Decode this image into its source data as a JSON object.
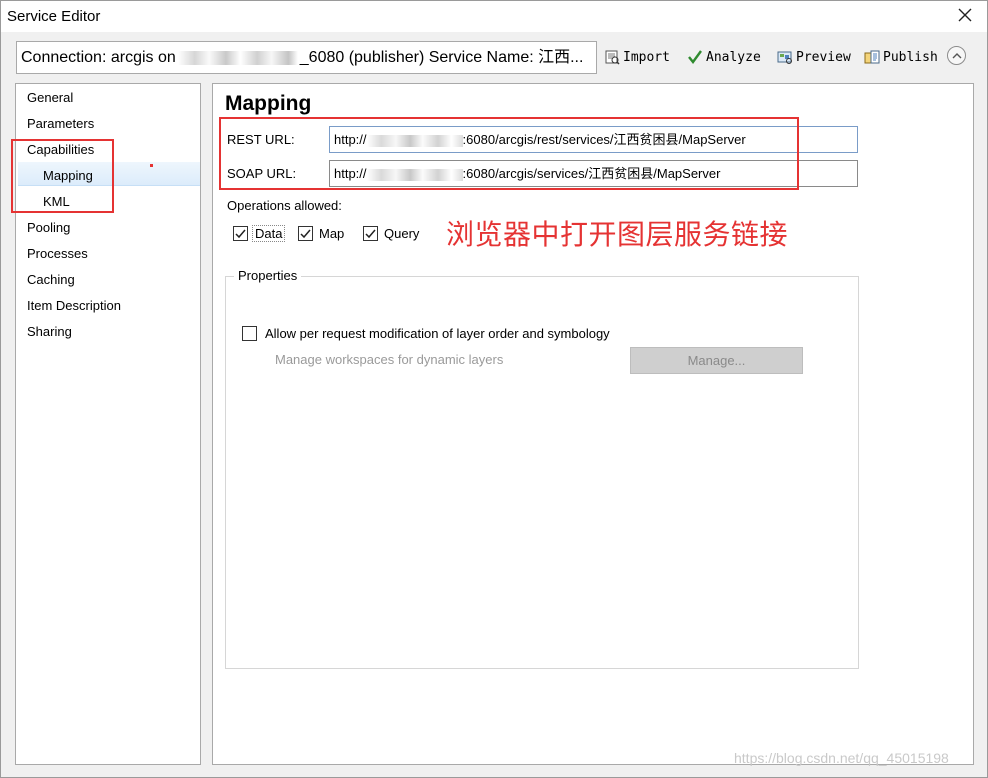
{
  "window": {
    "title": "Service Editor",
    "close_icon": "close-icon"
  },
  "toolbar": {
    "connection_prefix": "Connection: arcgis on",
    "connection_suffix": "_6080 (publisher)   Service Name: 江西...",
    "import_label": "Import",
    "analyze_label": "Analyze",
    "preview_label": "Preview",
    "publish_label": "Publish",
    "icons": [
      "import-icon",
      "analyze-check-icon",
      "preview-icon",
      "publish-icon",
      "collapse-chevron-icon"
    ]
  },
  "sidebar": {
    "items": [
      {
        "label": "General"
      },
      {
        "label": "Parameters"
      },
      {
        "label": "Capabilities"
      },
      {
        "label": "Mapping",
        "selected": true
      },
      {
        "label": "KML"
      },
      {
        "label": "Pooling"
      },
      {
        "label": "Processes"
      },
      {
        "label": "Caching"
      },
      {
        "label": "Item Description"
      },
      {
        "label": "Sharing"
      }
    ]
  },
  "main": {
    "heading": "Mapping",
    "rest_label": "REST URL:",
    "rest_prefix": "http://",
    "rest_suffix": ":6080/arcgis/rest/services/江西贫困县/MapServer",
    "soap_label": "SOAP URL:",
    "soap_prefix": "http://",
    "soap_suffix": ":6080/arcgis/services/江西贫困县/MapServer",
    "operations_label": "Operations allowed:",
    "operations": [
      {
        "label": "Data",
        "checked": true
      },
      {
        "label": "Map",
        "checked": true
      },
      {
        "label": "Query",
        "checked": true
      }
    ],
    "properties": {
      "legend": "Properties",
      "allow_label": "Allow per request modification of layer order and symbology",
      "allow_checked": false,
      "manage_text": "Manage workspaces for dynamic layers",
      "manage_button": "Manage..."
    }
  },
  "annotation": {
    "text": "浏览器中打开图层服务链接",
    "color": "#e53333"
  },
  "watermark": "https://blog.csdn.net/qq_45015198",
  "colors": {
    "accent_red": "#e53333",
    "selected_bg": "#dcecfb",
    "field_border": "#7a9cc8"
  }
}
